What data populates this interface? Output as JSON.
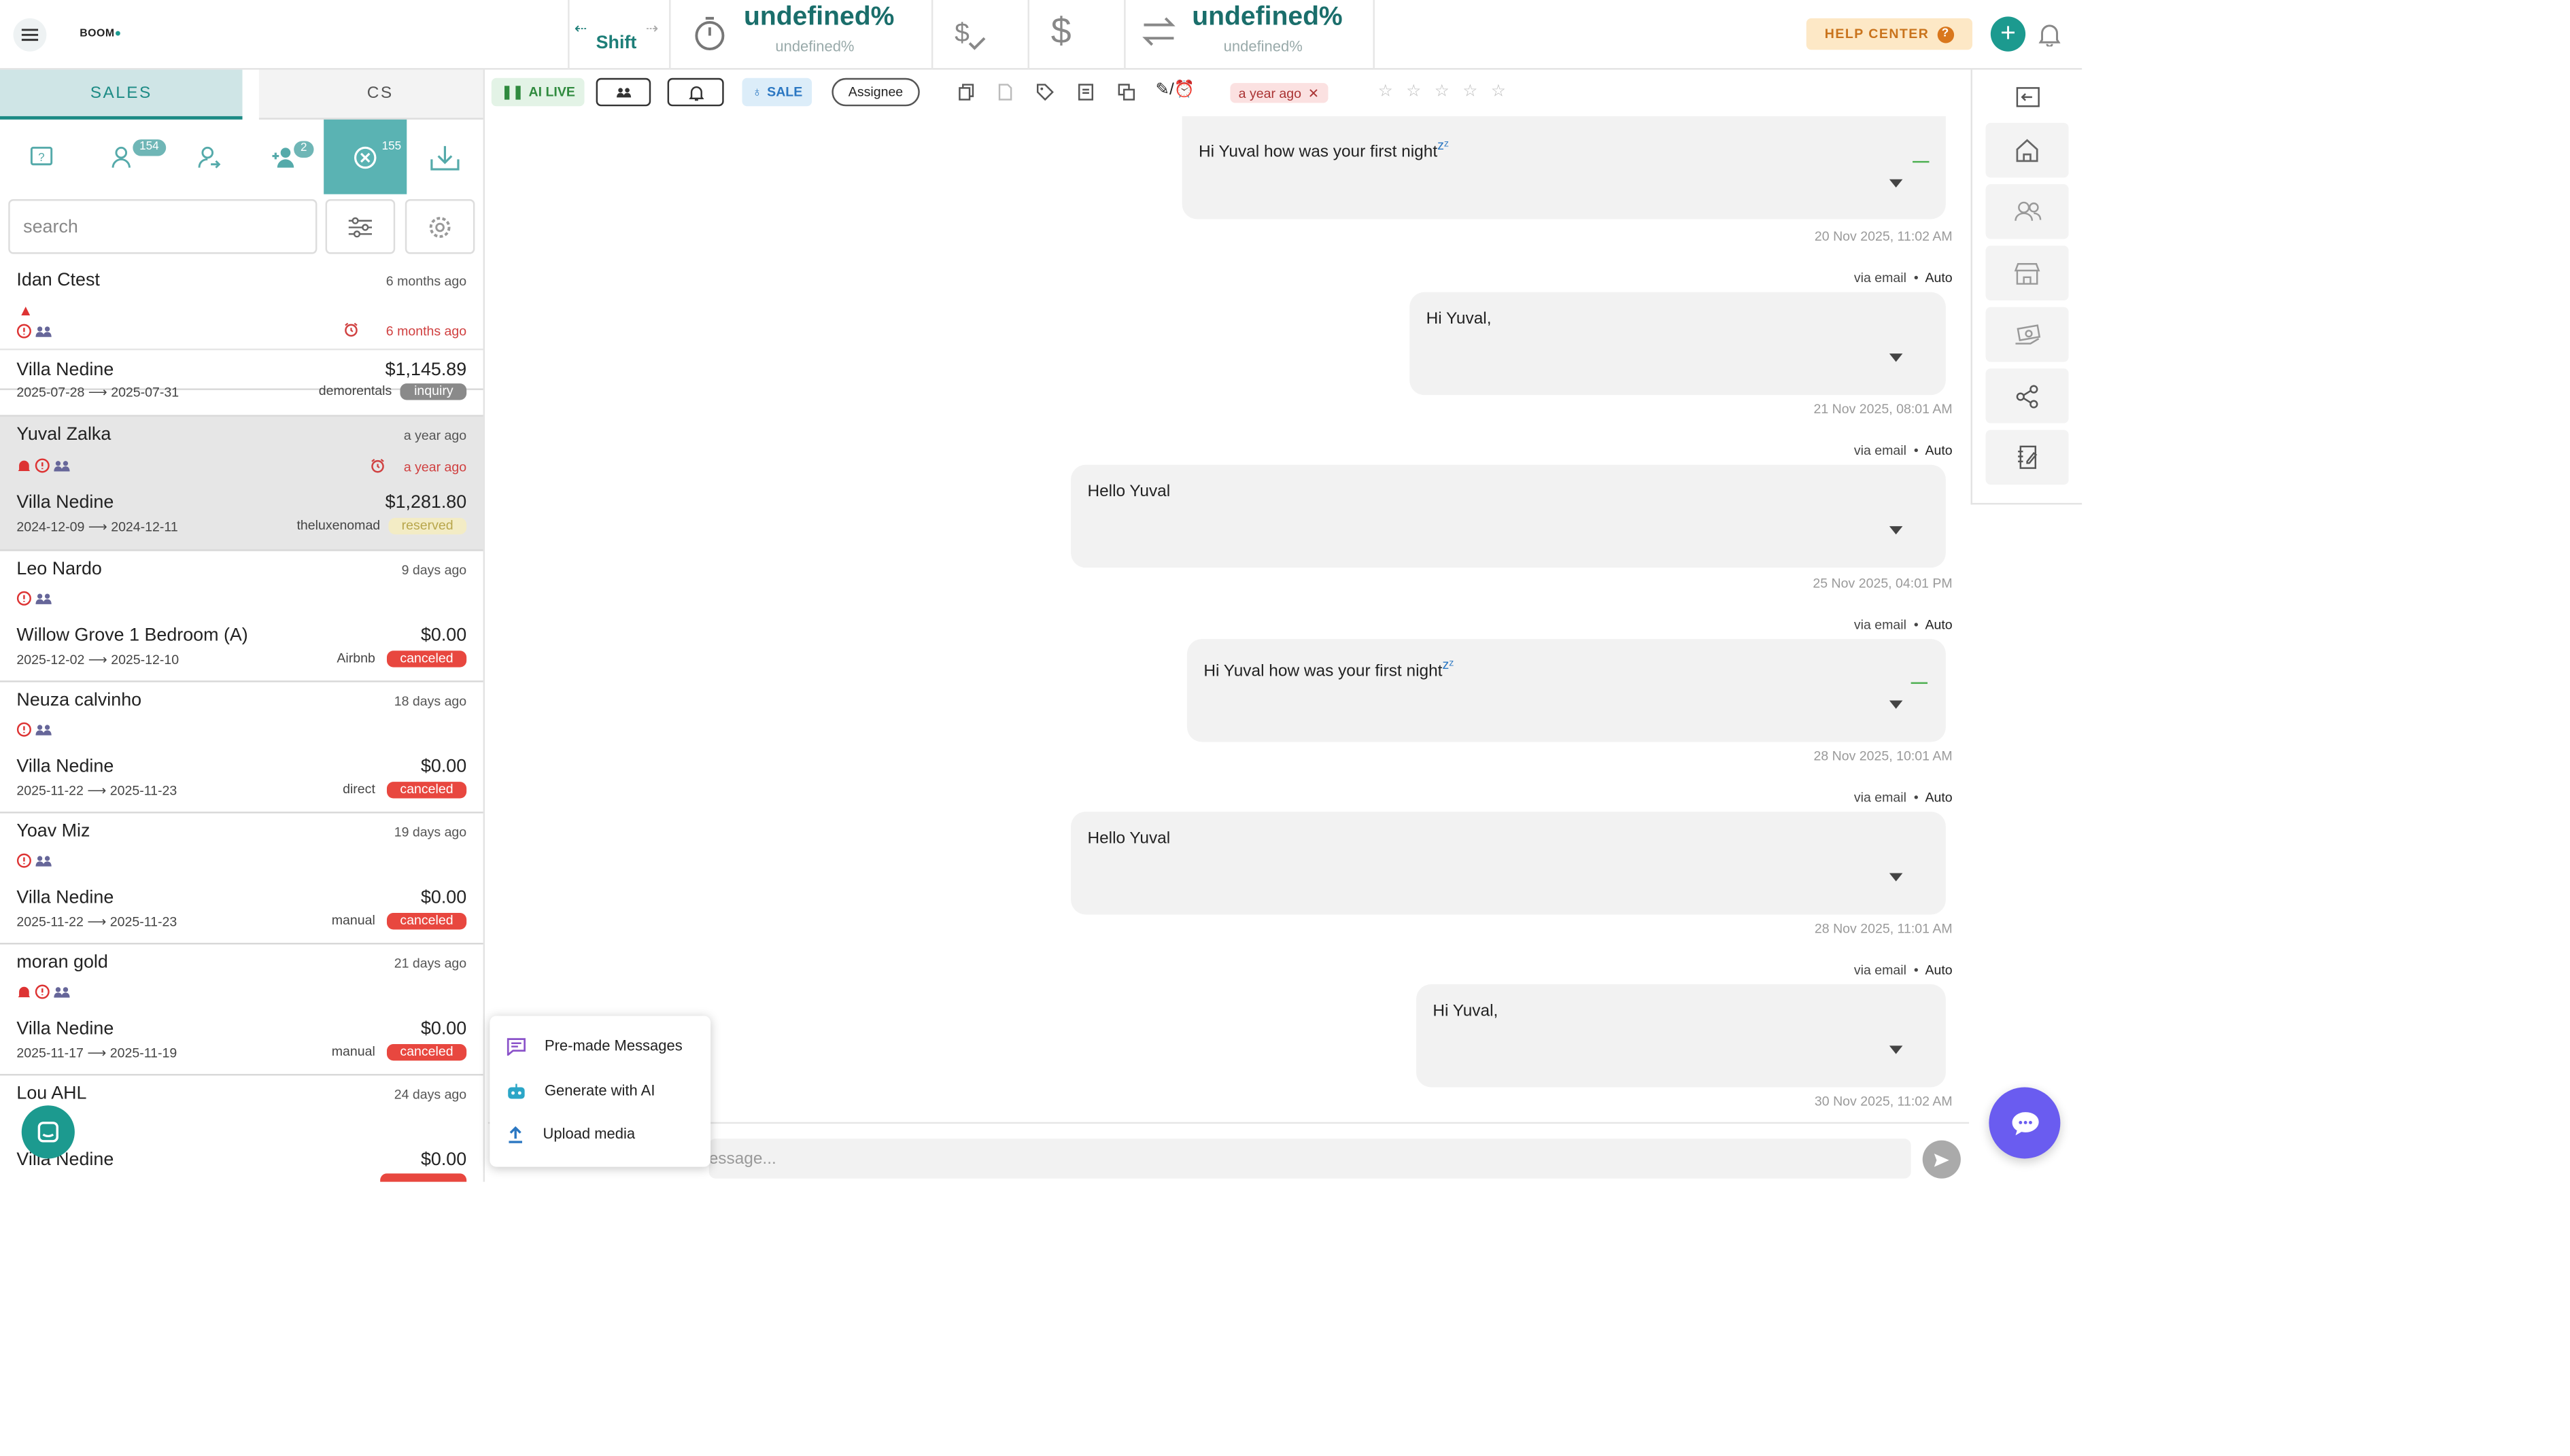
{
  "app": {
    "logo_text": "BOOM",
    "colors": {
      "accent": "#1c9a8f",
      "danger": "#e8473f",
      "fab": "#6a5cf0"
    }
  },
  "topbar": {
    "shift_label": "Shift",
    "stat1_big": "undefined%",
    "stat1_small": "undefined%",
    "stat2_big": "undefined%",
    "stat2_small": "undefined%",
    "help_label": "HELP CENTER",
    "help_q": "?",
    "plus": "+"
  },
  "left": {
    "tabs": [
      "SALES",
      "CS"
    ],
    "badges": {
      "guests": "154",
      "add": "2",
      "canceled": "155"
    },
    "search_placeholder": "search",
    "conversations": [
      {
        "name": "Idan Ctest",
        "time": "6 months ago",
        "time2": "6 months ago",
        "property": "Villa Nedine",
        "price": "$1,145.89",
        "dates": "2025-07-28 ⟶ 2025-07-31",
        "source": "demorentals",
        "status": "inquiry"
      },
      {
        "name": "Yuval Zalka",
        "time": "a year ago",
        "time2": "a year ago",
        "property": "Villa Nedine",
        "price": "$1,281.80",
        "dates": "2024-12-09 ⟶ 2024-12-11",
        "source": "theluxenomad",
        "status": "reserved"
      },
      {
        "name": "Leo Nardo",
        "time": "9 days ago",
        "property": "Willow Grove 1 Bedroom (A)",
        "price": "$0.00",
        "dates": "2025-12-02 ⟶ 2025-12-10",
        "source": "Airbnb",
        "status": "canceled"
      },
      {
        "name": "Neuza calvinho",
        "time": "18 days ago",
        "property": "Villa Nedine",
        "price": "$0.00",
        "dates": "2025-11-22 ⟶ 2025-11-23",
        "source": "direct",
        "status": "canceled"
      },
      {
        "name": "Yoav Miz",
        "time": "19 days ago",
        "property": "Villa Nedine",
        "price": "$0.00",
        "dates": "2025-11-22 ⟶ 2025-11-23",
        "source": "manual",
        "status": "canceled"
      },
      {
        "name": "moran gold",
        "time": "21 days ago",
        "property": "Villa Nedine",
        "price": "$0.00",
        "dates": "2025-11-17 ⟶ 2025-11-19",
        "source": "manual",
        "status": "canceled"
      },
      {
        "name": "Lou AHL",
        "time": "24 days ago",
        "property": "Villa Nedine",
        "price": "$0.00",
        "dates": "",
        "source": "",
        "status": ""
      }
    ]
  },
  "toolbar": {
    "ai_live": "AI LIVE",
    "sale": "SALE",
    "assignee": "Assignee",
    "time_pill": "a year ago",
    "stars": [
      "☆",
      "☆",
      "☆",
      "☆",
      "☆"
    ]
  },
  "messages": [
    {
      "text": "Hi Yuval how was your first night",
      "emoji": "zᶻ",
      "timestamp": "20 Nov 2025, 11:02 AM"
    },
    {
      "via": "via email",
      "auto": "Auto",
      "text": "Hi Yuval,",
      "timestamp": "21 Nov 2025, 08:01 AM"
    },
    {
      "via": "via email",
      "auto": "Auto",
      "text": "Hello Yuval",
      "timestamp": "25 Nov 2025, 04:01 PM"
    },
    {
      "via": "via email",
      "auto": "Auto",
      "text": "Hi Yuval how was your first night",
      "emoji": "zᶻ",
      "timestamp": "28 Nov 2025, 10:01 AM"
    },
    {
      "via": "via email",
      "auto": "Auto",
      "text": "Hello Yuval",
      "timestamp": "28 Nov 2025, 11:01 AM"
    },
    {
      "via": "via email",
      "auto": "Auto",
      "text": "Hi Yuval,",
      "timestamp": "30 Nov 2025, 11:02 AM"
    }
  ],
  "composer": {
    "placeholder": "essage..."
  },
  "popup": {
    "items": [
      "Pre-made Messages",
      "Generate with AI",
      "Upload media"
    ]
  }
}
